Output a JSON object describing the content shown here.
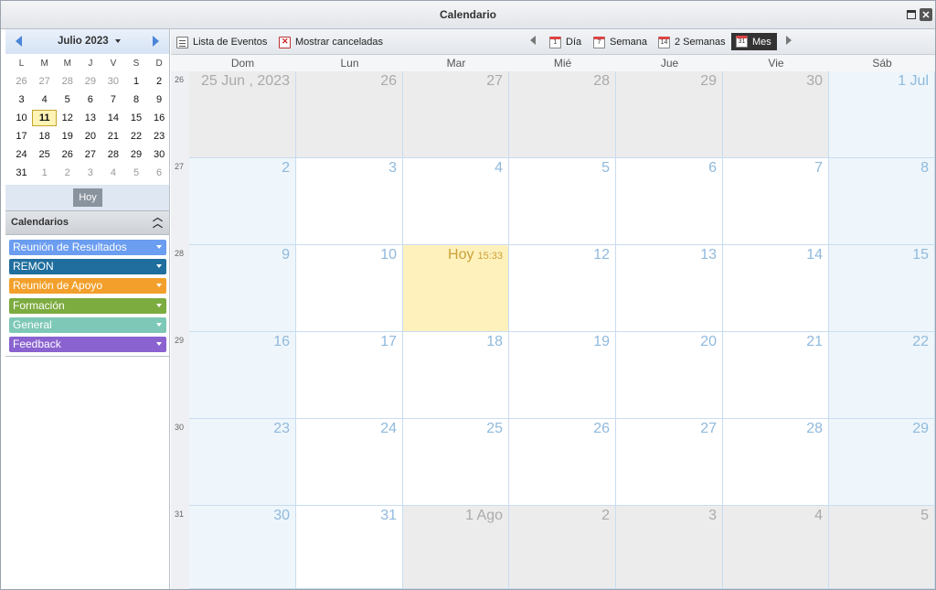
{
  "window": {
    "title": "Calendario"
  },
  "mini_calendar": {
    "title": "Julio 2023",
    "weekdays": [
      "L",
      "M",
      "M",
      "J",
      "V",
      "S",
      "D"
    ],
    "weeks": [
      [
        "26",
        "27",
        "28",
        "29",
        "30",
        "1",
        "2"
      ],
      [
        "3",
        "4",
        "5",
        "6",
        "7",
        "8",
        "9"
      ],
      [
        "10",
        "11",
        "12",
        "13",
        "14",
        "15",
        "16"
      ],
      [
        "17",
        "18",
        "19",
        "20",
        "21",
        "22",
        "23"
      ],
      [
        "24",
        "25",
        "26",
        "27",
        "28",
        "29",
        "30"
      ],
      [
        "31",
        "1",
        "2",
        "3",
        "4",
        "5",
        "6"
      ]
    ],
    "today_label": "Hoy"
  },
  "calendars": {
    "header": "Calendarios",
    "items": [
      {
        "label": "Reunión de Resultados",
        "color": "#6b9df0"
      },
      {
        "label": "REMON",
        "color": "#1f6e9d"
      },
      {
        "label": "Reunión de Apoyo",
        "color": "#f2a02b"
      },
      {
        "label": "Formación",
        "color": "#7cab3f"
      },
      {
        "label": "General",
        "color": "#7ec8b7"
      },
      {
        "label": "Feedback",
        "color": "#8a63d0"
      }
    ]
  },
  "toolbar": {
    "event_list": "Lista de Eventos",
    "show_canceled": "Mostrar canceladas",
    "day": "Día",
    "week": "Semana",
    "two_weeks": "2 Semanas",
    "month": "Mes",
    "active_view": "Mes"
  },
  "month_view": {
    "weekdays": [
      "Dom",
      "Lun",
      "Mar",
      "Mié",
      "Jue",
      "Vie",
      "Sáb"
    ],
    "week_numbers": [
      "26",
      "27",
      "28",
      "29",
      "30",
      "31"
    ],
    "weeks": [
      [
        "25 Jun , 2023",
        "26",
        "27",
        "28",
        "29",
        "30",
        "1 Jul"
      ],
      [
        "2",
        "3",
        "4",
        "5",
        "6",
        "7",
        "8"
      ],
      [
        "9",
        "10",
        "Hoy",
        "12",
        "13",
        "14",
        "15"
      ],
      [
        "16",
        "17",
        "18",
        "19",
        "20",
        "21",
        "22"
      ],
      [
        "23",
        "24",
        "25",
        "26",
        "27",
        "28",
        "29"
      ],
      [
        "30",
        "31",
        "1 Ago",
        "2",
        "3",
        "4",
        "5"
      ]
    ],
    "today_time": "15:33"
  }
}
